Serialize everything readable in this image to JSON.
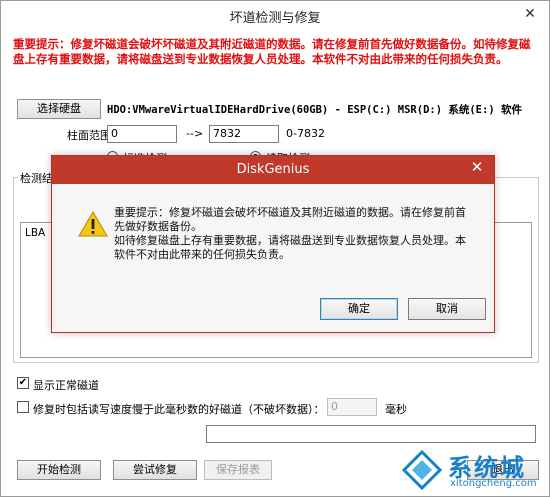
{
  "window": {
    "title": "坏道检测与修复",
    "close_glyph": "✕"
  },
  "warning_text": "重要提示：修复坏磁道会破坏坏磁道及其附近磁道的数据。请在修复前首先做好数据备份。如待修复磁盘上存有重要数据，请将磁盘送到专业数据恢复人员处理。本软件不对由此带来的任何损失负责。",
  "disk": {
    "select_button": "选择硬盘",
    "info": "HDO:VMwareVirtualIDEHardDrive(60GB) - ESP(C:) MSR(D:) 系统(E:) 软件"
  },
  "range": {
    "label": "柱面范围：",
    "from": "0",
    "arrow": "-->",
    "to": "7832",
    "hint": "0-7832"
  },
  "mode": {
    "standard": "标准检测",
    "fast": "读取检测"
  },
  "results": {
    "legend": "检测结果",
    "column": "LBA"
  },
  "options": {
    "show_normal": "显示正常磁道",
    "show_normal_mark": "✔",
    "include_slow": "修复时包括读写速度慢于此毫秒数的好磁道（不破坏数据）：",
    "ms_value": "0",
    "ms_unit": "毫秒"
  },
  "buttons": {
    "start": "开始检测",
    "try_repair": "尝试修复",
    "save_report": "保存报表",
    "exit": "退出"
  },
  "dialog": {
    "title": "DiskGenius",
    "close_glyph": "✕",
    "message_1": "重要提示：修复坏磁道会破坏坏磁道及其附近磁道的数据。请在修复前首先做好数据备份。",
    "message_2": "如待修复磁盘上存有重要数据，请将磁盘送到专业数据恢复人员处理。本软件不对由此带来的任何损失负责。",
    "ok": "确定",
    "cancel": "取消"
  },
  "watermark": {
    "brand": "系统城",
    "site": "xitongcheng.com"
  },
  "colors": {
    "warning_red": "#e01010",
    "dialog_title_red": "#c0392b",
    "watermark_blue": "#1a7fc8"
  }
}
